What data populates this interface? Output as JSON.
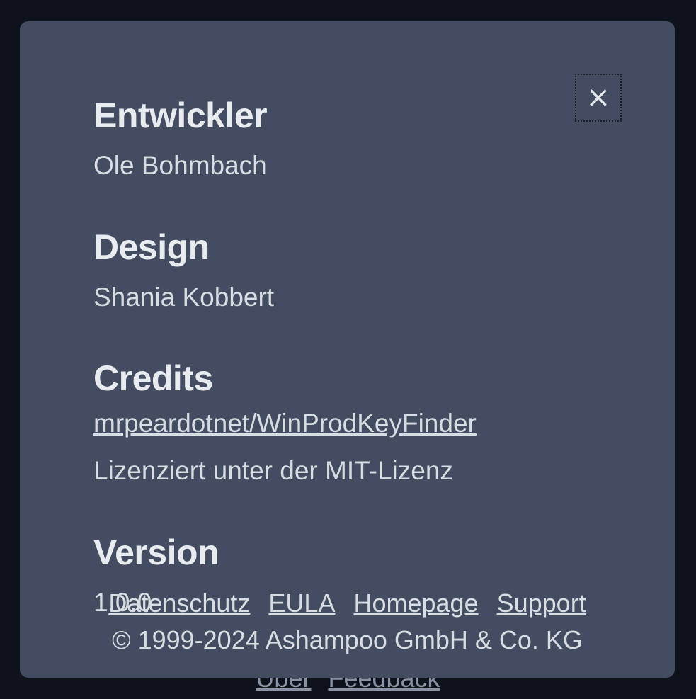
{
  "sections": {
    "developer": {
      "heading": "Entwickler",
      "value": "Ole Bohmbach"
    },
    "design": {
      "heading": "Design",
      "value": "Shania Kobbert"
    },
    "credits": {
      "heading": "Credits",
      "link": "mrpeardotnet/WinProdKeyFinder",
      "license": "Lizenziert unter der MIT-Lizenz"
    },
    "version": {
      "heading": "Version",
      "value": "1.0.0"
    }
  },
  "footer": {
    "links": {
      "privacy": "Datenschutz",
      "eula": "EULA",
      "homepage": "Homepage",
      "support": "Support"
    },
    "copyright": "© 1999-2024 Ashampoo GmbH & Co. KG"
  },
  "background": {
    "about": "Über",
    "feedback": "Feedback"
  }
}
